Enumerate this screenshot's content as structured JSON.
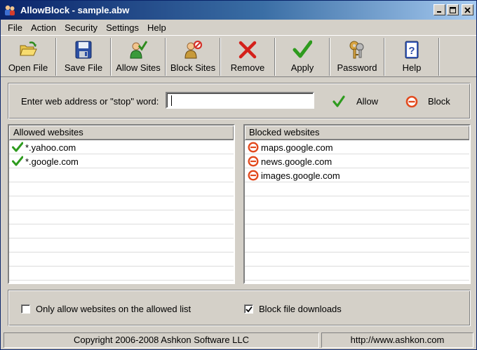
{
  "window": {
    "title": "AllowBlock - sample.abw",
    "minimize": "_",
    "maximize": "□",
    "close": "×"
  },
  "menu": [
    {
      "label": "File"
    },
    {
      "label": "Action"
    },
    {
      "label": "Security"
    },
    {
      "label": "Settings"
    },
    {
      "label": "Help"
    }
  ],
  "toolbar": {
    "open_file": "Open File",
    "save_file": "Save File",
    "allow_sites": "Allow Sites",
    "block_sites": "Block Sites",
    "remove": "Remove",
    "apply": "Apply",
    "password": "Password",
    "help": "Help"
  },
  "address": {
    "label": "Enter web address or \"stop\" word:",
    "value": "",
    "allow_label": "Allow",
    "block_label": "Block"
  },
  "allowed": {
    "header": "Allowed websites",
    "items": [
      "*.yahoo.com",
      "*.google.com"
    ]
  },
  "blocked": {
    "header": "Blocked websites",
    "items": [
      "maps.google.com",
      "news.google.com",
      "images.google.com"
    ]
  },
  "options": {
    "only_allowed_label": "Only allow websites on the allowed list",
    "only_allowed_checked": false,
    "block_downloads_label": "Block file downloads",
    "block_downloads_checked": true
  },
  "status": {
    "copyright": "Copyright 2006-2008 Ashkon Software LLC",
    "url": "http://www.ashkon.com"
  },
  "colors": {
    "title_active": "#0a246a",
    "allow_green": "#2e8b1e",
    "block_red": "#e24a1e"
  }
}
